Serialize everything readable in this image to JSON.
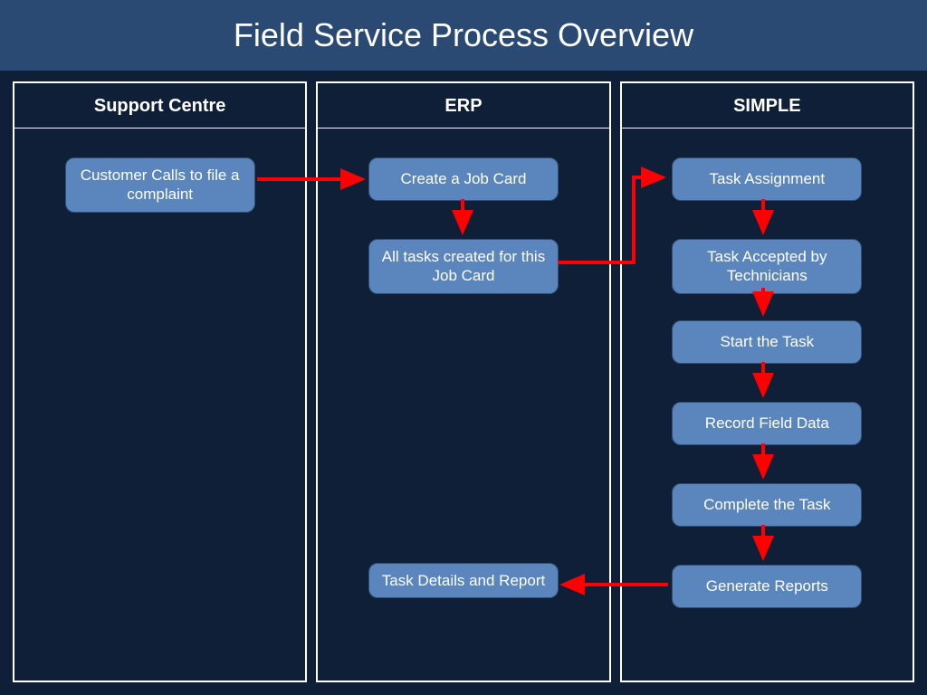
{
  "title": "Field Service Process Overview",
  "lanes": {
    "support": {
      "header": "Support Centre"
    },
    "erp": {
      "header": "ERP"
    },
    "simple": {
      "header": "SIMPLE"
    }
  },
  "nodes": {
    "customer_call": "Customer Calls to file a complaint",
    "create_job": "Create a Job Card",
    "tasks_created": "All tasks created for this Job Card",
    "task_details": "Task Details and Report",
    "task_assign": "Task Assignment",
    "task_accept": "Task Accepted by Technicians",
    "start_task": "Start the Task",
    "record_data": "Record Field Data",
    "complete_task": "Complete the Task",
    "gen_reports": "Generate Reports"
  }
}
